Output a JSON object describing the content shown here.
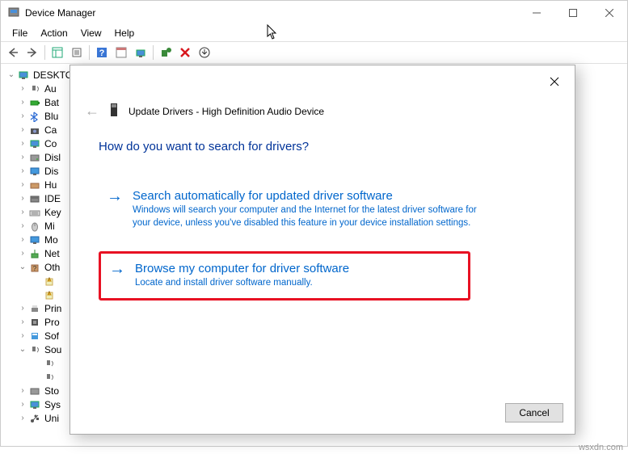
{
  "window": {
    "title": "Device Manager"
  },
  "menu": {
    "file": "File",
    "action": "Action",
    "view": "View",
    "help": "Help"
  },
  "tree": {
    "root": "DESKTO",
    "items": [
      {
        "label": "Au",
        "icon": "audio"
      },
      {
        "label": "Bat",
        "icon": "battery"
      },
      {
        "label": "Blu",
        "icon": "bluetooth"
      },
      {
        "label": "Ca",
        "icon": "camera"
      },
      {
        "label": "Co",
        "icon": "computer"
      },
      {
        "label": "Disl",
        "icon": "disk"
      },
      {
        "label": "Dis",
        "icon": "display"
      },
      {
        "label": "Hu",
        "icon": "hid"
      },
      {
        "label": "IDE",
        "icon": "ide"
      },
      {
        "label": "Key",
        "icon": "keyboard"
      },
      {
        "label": "Mi",
        "icon": "mouse"
      },
      {
        "label": "Mo",
        "icon": "monitor"
      },
      {
        "label": "Net",
        "icon": "network"
      },
      {
        "label": "Oth",
        "icon": "other",
        "expanded": true,
        "children": [
          {
            "label": "",
            "icon": "unknown"
          },
          {
            "label": "",
            "icon": "unknown"
          }
        ]
      },
      {
        "label": "Prin",
        "icon": "print"
      },
      {
        "label": "Pro",
        "icon": "processor"
      },
      {
        "label": "Sof",
        "icon": "software"
      },
      {
        "label": "Sou",
        "icon": "sound",
        "expanded": true,
        "children": [
          {
            "label": "",
            "icon": "sound"
          },
          {
            "label": "",
            "icon": "sound"
          }
        ]
      },
      {
        "label": "Sto",
        "icon": "storage"
      },
      {
        "label": "Sys",
        "icon": "system"
      },
      {
        "label": "Uni",
        "icon": "usb"
      }
    ]
  },
  "dialog": {
    "title": "Update Drivers - High Definition Audio Device",
    "question": "How do you want to search for drivers?",
    "option1": {
      "title": "Search automatically for updated driver software",
      "desc": "Windows will search your computer and the Internet for the latest driver software for your device, unless you've disabled this feature in your device installation settings."
    },
    "option2": {
      "title": "Browse my computer for driver software",
      "desc": "Locate and install driver software manually."
    },
    "cancel": "Cancel"
  },
  "watermark": "wsxdn.com"
}
